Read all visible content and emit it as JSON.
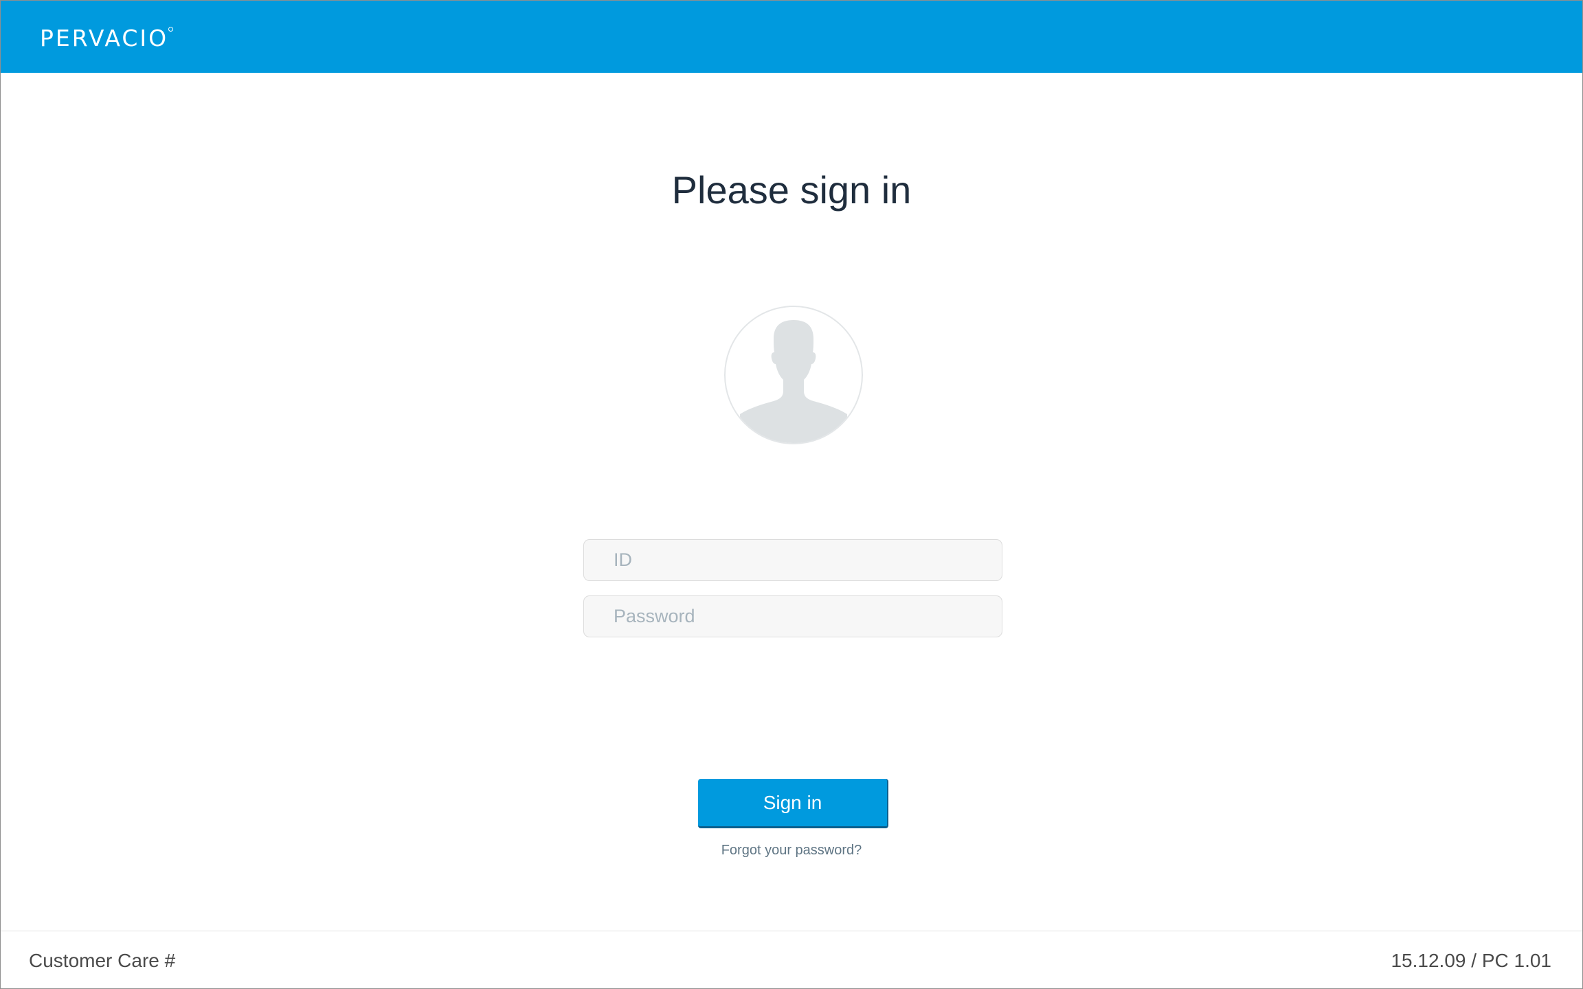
{
  "header": {
    "brand": "PERVACIO",
    "background_color": "#009ade"
  },
  "main": {
    "title": "Please sign in",
    "avatar_icon": "user-silhouette-icon",
    "id_field": {
      "placeholder": "ID",
      "value": ""
    },
    "password_field": {
      "placeholder": "Password",
      "value": ""
    },
    "signin_label": "Sign in",
    "forgot_label": "Forgot your password?"
  },
  "footer": {
    "customer_care": "Customer Care #",
    "version": "15.12.09 / PC 1.01"
  }
}
